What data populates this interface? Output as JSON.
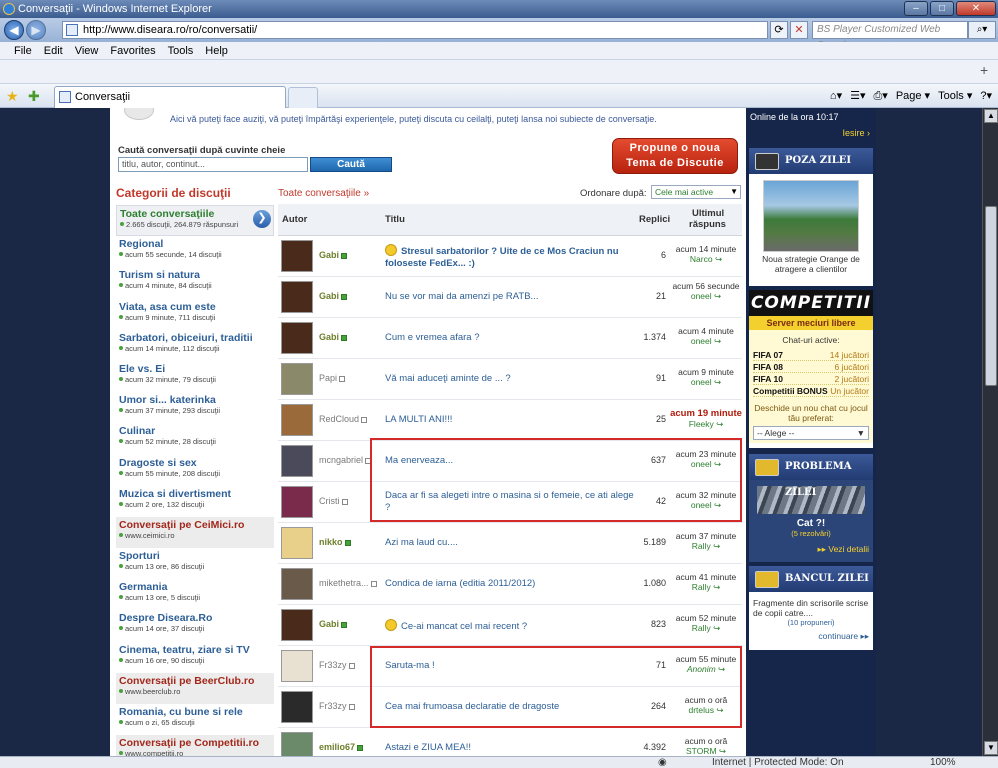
{
  "browser": {
    "title": "Conversaţii - Windows Internet Explorer",
    "url": "http://www.diseara.ro/ro/conversatii/",
    "search_placeholder": "BS Player Customized Web Search",
    "menu": [
      "File",
      "Edit",
      "View",
      "Favorites",
      "Tools",
      "Help"
    ],
    "tab_title": "Conversaţii",
    "cmd": [
      "Page ▾",
      "Tools ▾"
    ],
    "status_zone": "Internet | Protected Mode: On",
    "zoom": "100%"
  },
  "page": {
    "intro": "Aici vă puteţi face auziţi, vă puteţi împărtăşi experienţele, puteţi discuta cu ceilalţi, puteţi lansa noi subiecte de conversaţie.",
    "search_label": "Caută conversaţii după cuvinte cheie",
    "search_placeholder": "titlu, autor, continut...",
    "search_button": "Caută",
    "propune_line1": "Propune o noua",
    "propune_line2": "Tema de Discutie",
    "categories_title": "Categorii de discuţii",
    "breadcrumb": "Toate conversaţiile »",
    "order_label": "Ordonare după:",
    "order_value": "Cele mai active",
    "col_author": "Autor",
    "col_title": "Titlu",
    "col_replies": "Replici",
    "col_last1": "Ultimul",
    "col_last2": "răspuns"
  },
  "categories": [
    {
      "name": "Toate conversaţiile",
      "info": "2.665 discuţii, 264.879 răspunsuri",
      "style": "active"
    },
    {
      "name": "Regional",
      "info": "acum 55 secunde, 14 discuţii",
      "style": ""
    },
    {
      "name": "Turism si natura",
      "info": "acum 4 minute, 84 discuţii",
      "style": ""
    },
    {
      "name": "Viata, asa cum este",
      "info": "acum 9 minute, 711 discuţii",
      "style": ""
    },
    {
      "name": "Sarbatori, obiceiuri, traditii",
      "info": "acum 14 minute, 112 discuţii",
      "style": ""
    },
    {
      "name": "Ele vs. Ei",
      "info": "acum 32 minute, 79 discuţii",
      "style": ""
    },
    {
      "name": "Umor si... katerinka",
      "info": "acum 37 minute, 293 discuţii",
      "style": ""
    },
    {
      "name": "Culinar",
      "info": "acum 52 minute, 28 discuţii",
      "style": ""
    },
    {
      "name": "Dragoste si sex",
      "info": "acum 55 minute, 208 discuţii",
      "style": ""
    },
    {
      "name": "Muzica si divertisment",
      "info": "acum 2 ore, 132 discuţii",
      "style": ""
    },
    {
      "name": "Conversaţii pe CeiMici.ro",
      "info": "www.ceimici.ro",
      "style": "red"
    },
    {
      "name": "Sporturi",
      "info": "acum 13 ore, 86 discuţii",
      "style": ""
    },
    {
      "name": "Germania",
      "info": "acum 13 ore, 5 discuţii",
      "style": ""
    },
    {
      "name": "Despre Diseara.Ro",
      "info": "acum 14 ore, 37 discuţii",
      "style": ""
    },
    {
      "name": "Cinema, teatru, ziare si TV",
      "info": "acum 16 ore, 90 discuţii",
      "style": ""
    },
    {
      "name": "Conversaţii pe BeerClub.ro",
      "info": "www.beerclub.ro",
      "style": "red"
    },
    {
      "name": "Romania, cu bune si rele",
      "info": "acum o zi, 65 discuţii",
      "style": ""
    },
    {
      "name": "Conversaţii pe Competitii.ro",
      "info": "www.competitii.ro",
      "style": "red"
    }
  ],
  "threads": [
    {
      "author": "Gabi",
      "online": true,
      "title": "Stresul sarbatorilor ? Uite de ce Mos Craciun nu foloseste FedEx... :)",
      "bold": true,
      "icon": "star-icon",
      "replies": "6",
      "last_time": "acum 14 minute",
      "last_user": "Narco",
      "avatar": "#4a2a1a"
    },
    {
      "author": "Gabi",
      "online": true,
      "title": "Nu se vor mai da amenzi pe RATB...",
      "bold": false,
      "icon": "",
      "replies": "21",
      "last_time": "acum 56 secunde",
      "last_user": "oneel",
      "avatar": "#4a2a1a"
    },
    {
      "author": "Gabi",
      "online": true,
      "title": "Cum e vremea afara ?",
      "bold": false,
      "icon": "",
      "replies": "1.374",
      "last_time": "acum 4 minute",
      "last_user": "oneel",
      "avatar": "#4a2a1a"
    },
    {
      "author": "Papi",
      "online": false,
      "title": "Vă mai aduceţi aminte de ... ?",
      "bold": false,
      "icon": "",
      "replies": "91",
      "last_time": "acum 9 minute",
      "last_user": "oneel",
      "avatar": "#8a8a6a"
    },
    {
      "author": "RedCloud",
      "online": false,
      "title": "LA MULTI ANI!!!",
      "bold": false,
      "icon": "",
      "replies": "25",
      "last_time": "acum 19 minute",
      "last_user": "Fleeky",
      "avatar": "#9a6a3a",
      "red_time": true
    },
    {
      "author": "mcngabriel",
      "online": false,
      "title": "Ma enerveaza...",
      "bold": false,
      "icon": "",
      "replies": "637",
      "last_time": "acum 23 minute",
      "last_user": "oneel",
      "avatar": "#4a4a5a"
    },
    {
      "author": "Cristi",
      "online": false,
      "title": "Daca ar fi sa alegeti intre o masina si o femeie, ce ati alege ?",
      "bold": false,
      "icon": "",
      "replies": "42",
      "last_time": "acum 32 minute",
      "last_user": "oneel",
      "avatar": "#7a2a4a"
    },
    {
      "author": "nikko",
      "online": true,
      "title": "Azi ma laud cu....",
      "bold": false,
      "icon": "",
      "replies": "5.189",
      "last_time": "acum 37 minute",
      "last_user": "Rally",
      "avatar": "#e8d08a"
    },
    {
      "author": "mikethetra...",
      "online": false,
      "title": "Condica de iarna (editia 2011/2012)",
      "bold": false,
      "icon": "",
      "replies": "1.080",
      "last_time": "acum 41 minute",
      "last_user": "Rally",
      "avatar": "#6a5a4a"
    },
    {
      "author": "Gabi",
      "online": true,
      "title": "Ce-ai mancat cel mai recent ?",
      "bold": false,
      "icon": "smile-icon",
      "replies": "823",
      "last_time": "acum 52 minute",
      "last_user": "Rally",
      "avatar": "#4a2a1a"
    },
    {
      "author": "Fr33zy",
      "online": false,
      "title": "Saruta-ma !",
      "bold": false,
      "icon": "",
      "replies": "71",
      "last_time": "acum 55 minute",
      "last_user": "Anonim",
      "last_user_italic": true,
      "avatar": "#e8e0d0"
    },
    {
      "author": "Fr33zy",
      "online": false,
      "title": "Cea mai frumoasa declaratie de dragoste",
      "bold": false,
      "icon": "",
      "replies": "264",
      "last_time": "acum o oră",
      "last_user": "drtelus",
      "avatar": "#2a2a2a"
    },
    {
      "author": "emilio67",
      "online": true,
      "title": "Astazi e ZIUA MEA!!",
      "bold": false,
      "icon": "",
      "replies": "4.392",
      "last_time": "acum o oră",
      "last_user": "STORM",
      "avatar": "#6a8a6a"
    }
  ],
  "sidebar": {
    "online": "Online de la ora 10:17",
    "iesire": "Iesire ›",
    "poza_title": "POZA ZILEI",
    "poza_caption": "Noua strategie Orange de atragere a clientilor",
    "competitii_logo": "COMPETITII",
    "competitii_sub": "Server meciuri libere",
    "chat_label": "Chat-uri active:",
    "chats": [
      {
        "name": "FIFA 07",
        "count": "14 jucători"
      },
      {
        "name": "FIFA 08",
        "count": "6 jucători"
      },
      {
        "name": "FIFA 10",
        "count": "2 jucători"
      },
      {
        "name": "Competitii BONUS",
        "count": "Un jucător"
      }
    ],
    "deschide": "Deschide un nou chat cu jocul tău preferat:",
    "alege": "-- Alege --",
    "problema_title": "PROBLEMA ZILEI",
    "problema_caption": "Cat ?!",
    "problema_sub": "(5 rezolvări)",
    "problema_more": "▸▸ Vezi detalii",
    "banc_title": "BANCUL ZILEI",
    "banc_text": "Fragmente din scrisorile scrise de copii catre....",
    "banc_sub": "(10 propuneri)",
    "banc_more": "continuare ▸▸"
  }
}
